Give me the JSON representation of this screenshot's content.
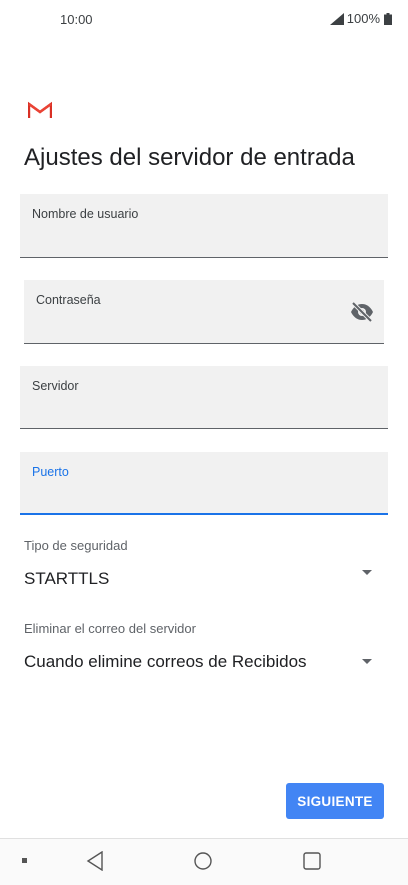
{
  "status_bar": {
    "time": "10:00",
    "battery": "100%"
  },
  "screen": {
    "title": "Ajustes del servidor de entrada"
  },
  "fields": {
    "username": {
      "label": "Nombre de usuario",
      "value": ""
    },
    "password": {
      "label": "Contraseña",
      "value": ""
    },
    "server": {
      "label": "Servidor",
      "value": ""
    },
    "port": {
      "label": "Puerto",
      "value": ""
    }
  },
  "security": {
    "label": "Tipo de seguridad",
    "value": "STARTTLS"
  },
  "delete_mail": {
    "label": "Eliminar el correo del servidor",
    "value": "Cuando elimine correos de Recibidos"
  },
  "actions": {
    "next_label": "SIGUIENTE"
  },
  "colors": {
    "accent": "#1a73e8",
    "button": "#4285f4",
    "field_bg": "#f1f1f1"
  }
}
